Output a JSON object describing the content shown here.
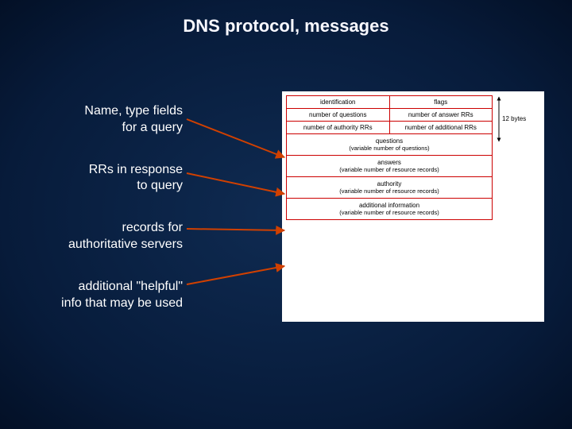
{
  "title": "DNS protocol, messages",
  "labels": {
    "query": {
      "line1": "Name, type fields",
      "line2": "for a query"
    },
    "response": {
      "line1": "RRs in response",
      "line2": "to query"
    },
    "authority": {
      "line1": "records for",
      "line2": "authoritative servers"
    },
    "additional": {
      "line1": "additional \"helpful\"",
      "line2": "info that may be used"
    }
  },
  "header": {
    "r1c1": "identification",
    "r1c2": "flags",
    "r2c1": "number of questions",
    "r2c2": "number of answer RRs",
    "r3c1": "number of authority RRs",
    "r3c2": "number of additional RRs"
  },
  "sections": {
    "questions": {
      "t": "questions",
      "s": "(variable number of questions)"
    },
    "answers": {
      "t": "answers",
      "s": "(variable number of resource records)"
    },
    "authority": {
      "t": "authority",
      "s": "(variable number of resource records)"
    },
    "additional": {
      "t": "additional information",
      "s": "(variable number of resource records)"
    }
  },
  "side": "12 bytes"
}
